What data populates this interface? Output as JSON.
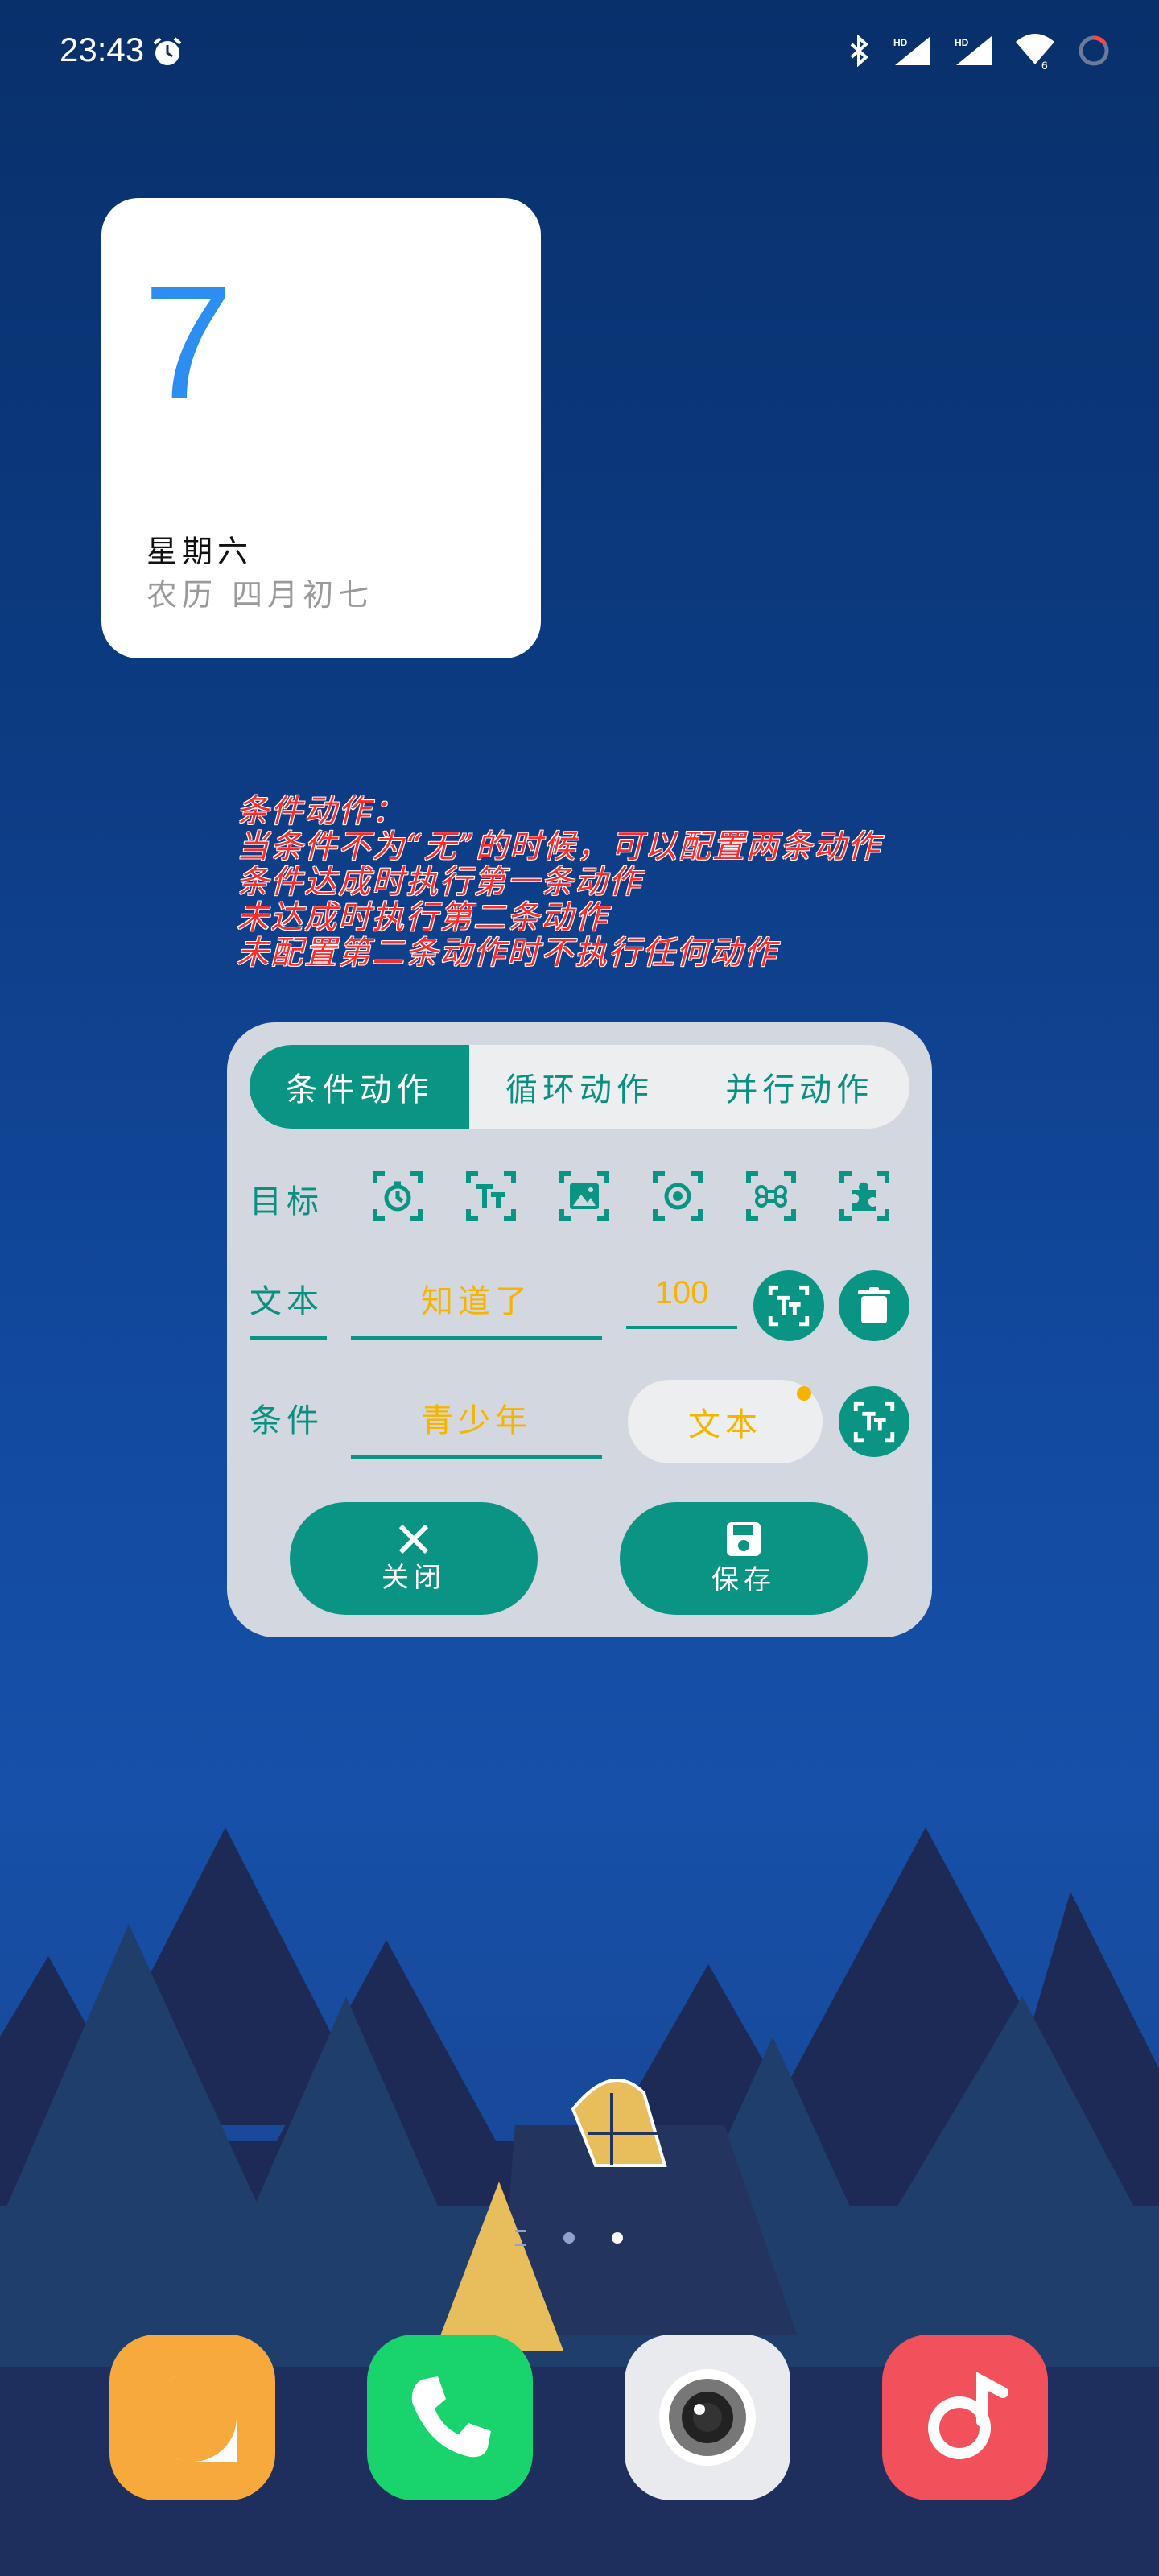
{
  "status_bar": {
    "time": "23:43",
    "icons": [
      "alarm-icon",
      "bluetooth-icon",
      "signal-hd-icon",
      "signal-hd-icon",
      "wifi-icon",
      "battery-icon"
    ],
    "wifi_badge": "6"
  },
  "calendar_widget": {
    "day": "7",
    "weekday": "星期六",
    "lunar": "农历 四月初七",
    "accent_color": "#2b8ef0"
  },
  "note": {
    "lines": [
      "条件动作：",
      "当条件不为“无”的时候，可以配置两条动作",
      "条件达成时执行第一条动作",
      "未达成时执行第二条动作",
      "未配置第二条动作时不执行任何动作"
    ],
    "color": "#ff2a2a"
  },
  "panel": {
    "tabs": [
      {
        "label": "条件动作",
        "active": true
      },
      {
        "label": "循环动作",
        "active": false
      },
      {
        "label": "并行动作",
        "active": false
      }
    ],
    "target_label": "目标",
    "target_icons": [
      "timer-icon",
      "text-icon",
      "image-icon",
      "locate-icon",
      "command-icon",
      "plugin-icon"
    ],
    "text_row": {
      "label": "文本",
      "value": "知道了",
      "number": "100",
      "buttons": [
        "text-select-icon",
        "trash-icon"
      ]
    },
    "condition_row": {
      "label": "条件",
      "value": "青少年",
      "type_button": "文本",
      "button": "text-select-icon"
    },
    "close_label": "关闭",
    "save_label": "保存",
    "accent_color": "#0a9484",
    "value_color": "#f5b400"
  },
  "dock": {
    "apps": [
      "messages-icon",
      "phone-icon",
      "camera-icon",
      "music-icon"
    ]
  }
}
